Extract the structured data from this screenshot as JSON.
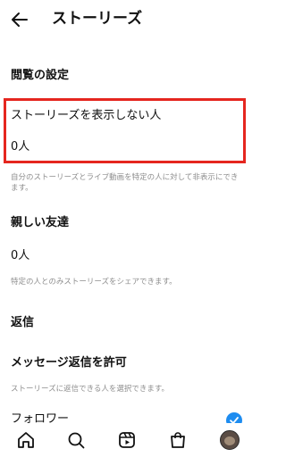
{
  "header": {
    "title": "ストーリーズ",
    "back_icon": "arrow-left-icon"
  },
  "view_settings": {
    "heading": "閲覧の設定",
    "hide_story_from": {
      "label": "ストーリーズを表示しない人",
      "value": "0人"
    },
    "hide_note": "自分のストーリーズとライブ動画を特定の人に対して非表示にできます。"
  },
  "close_friends": {
    "label": "親しい友達",
    "value": "0人",
    "note": "特定の人とのみストーリーズをシェアできます。"
  },
  "replies": {
    "heading": "返信",
    "allow_label": "メッセージ返信を許可",
    "note": "ストーリーズに返信できる人を選択できます。",
    "option_followers": "フォロワー",
    "option_followers_checked": true
  },
  "tab_bar": {
    "items": [
      "home-icon",
      "search-icon",
      "reels-icon",
      "shop-icon",
      "profile-avatar"
    ]
  },
  "colors": {
    "highlight": "#e5261f",
    "check": "#1d8cf0",
    "muted": "#8e8e8e"
  }
}
